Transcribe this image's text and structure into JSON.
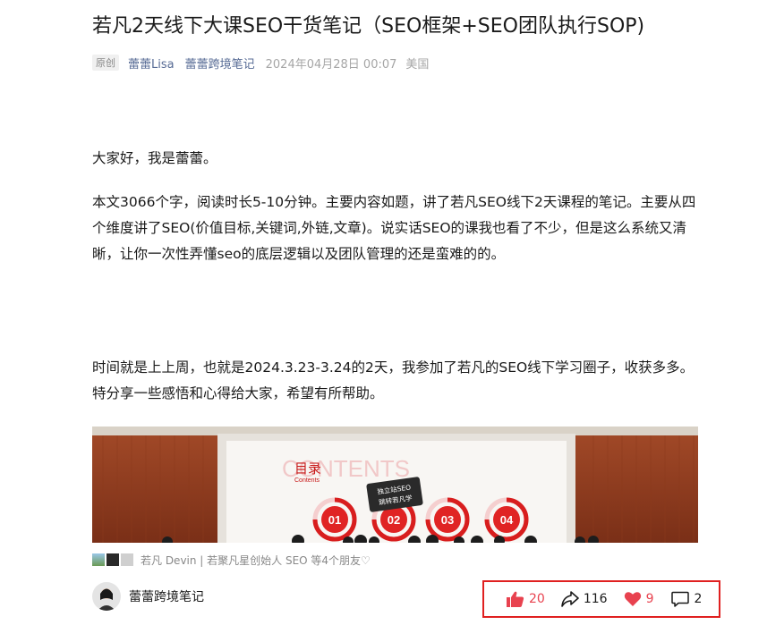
{
  "article": {
    "title": "若凡2天线下大课SEO干货笔记（SEO框架+SEO团队执行SOP)",
    "tag": "原创",
    "author": "蕾蕾Lisa",
    "account": "蕾蕾跨境笔记",
    "datetime": "2024年04月28日 00:07",
    "location": "美国",
    "paragraphs": [
      "大家好，我是蕾蕾。",
      "本文3066个字，阅读时长5-10分钟。主要内容如题，讲了若凡SEO线下2天课程的笔记。主要从四个维度讲了SEO(价值目标,关键词,外链,文章)。说实话SEO的课我也看了不少，但是这么系统又清晰，让你一次性弄懂seo的底层逻辑以及团队管理的还是蛮难的的。",
      "时间就是上上周，也就是2024.3.23-3.24的2天，我参加了若凡的SEO线下学习圈子，收获多多。特分享一些感悟和心得给大家，希望有所帮助。"
    ]
  },
  "photo": {
    "slide_title": "目录",
    "slide_subtitle": "Contents",
    "slide_watermark": "CONTENTS",
    "sign_line1": "独立站SEO",
    "sign_line2": "跳转若凡学",
    "numbers": [
      "01",
      "02",
      "03",
      "04"
    ]
  },
  "friends": {
    "text": "若凡 Devin | 若聚凡星创始人 SEO 等4个朋友♡"
  },
  "footer": {
    "account_name": "蕾蕾跨境笔记"
  },
  "actions": {
    "like": "20",
    "share": "116",
    "heart": "9",
    "comment": "2"
  },
  "colors": {
    "link": "#576b95",
    "highlight_border": "#e02020",
    "action_red": "#e8424f"
  }
}
